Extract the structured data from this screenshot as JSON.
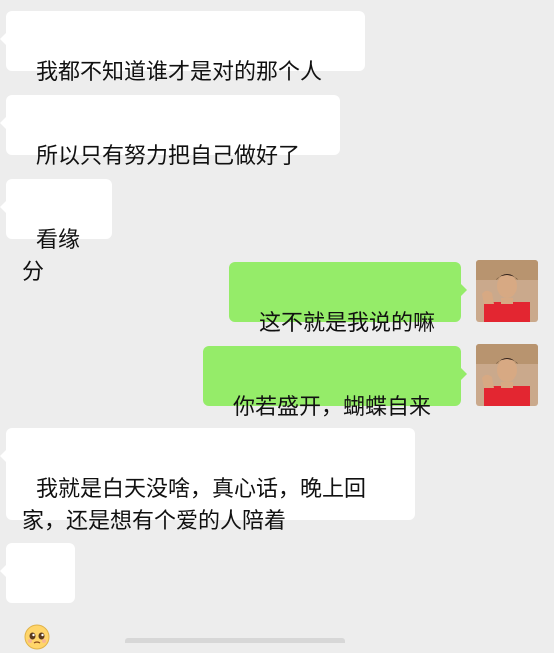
{
  "messages": [
    {
      "side": "left",
      "text": "我都不知道谁才是对的那个人"
    },
    {
      "side": "left",
      "text": "所以只有努力把自己做好了"
    },
    {
      "side": "left",
      "text": "看缘分"
    },
    {
      "side": "right",
      "text": "这不就是我说的嘛"
    },
    {
      "side": "right",
      "text": "你若盛开，蝴蝶自来"
    },
    {
      "side": "left",
      "text": "我就是白天没啥，真心话，晚上回\n家，还是想有个爱的人陪着"
    },
    {
      "side": "left",
      "emoji": "pleading-face-emoji"
    }
  ],
  "colors": {
    "background": "#ededed",
    "incoming_bubble": "#ffffff",
    "outgoing_bubble": "#95ec69",
    "avatar_shirt": "#e32631",
    "avatar_bg": "#caa98c"
  }
}
